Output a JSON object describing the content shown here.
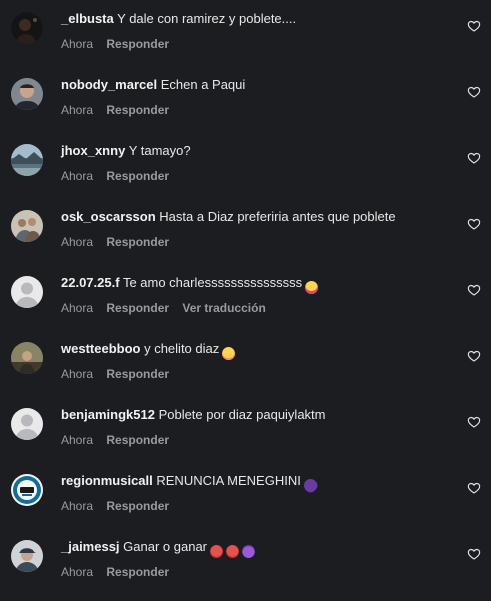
{
  "comments": [
    {
      "user": "_elbusta",
      "text": "Y dale con ramirez y poblete....",
      "time": "Ahora",
      "reply": "Responder",
      "translate": "",
      "emoji": [],
      "avatar": "dark-photo"
    },
    {
      "user": "nobody_marcel",
      "text": "Echen a Paqui",
      "time": "Ahora",
      "reply": "Responder",
      "translate": "",
      "emoji": [],
      "avatar": "portrait-photo"
    },
    {
      "user": "jhox_xnny",
      "text": "Y tamayo?",
      "time": "Ahora",
      "reply": "Responder",
      "translate": "",
      "emoji": [],
      "avatar": "landscape-photo"
    },
    {
      "user": "osk_oscarsson",
      "text": "Hasta a Diaz preferiria antes que poblete",
      "time": "Ahora",
      "reply": "Responder",
      "translate": "",
      "emoji": [],
      "avatar": "group-photo"
    },
    {
      "user": "22.07.25.f",
      "text": "Te amo charlesssssssssssssss",
      "time": "Ahora",
      "reply": "Responder",
      "translate": "Ver traducción",
      "emoji": [
        "star-struck-emoji"
      ],
      "avatar": "default"
    },
    {
      "user": "westteebboo",
      "text": "y chelito diaz",
      "time": "Ahora",
      "reply": "Responder",
      "translate": "",
      "emoji": [
        "flushed-emoji"
      ],
      "avatar": "outdoor-photo"
    },
    {
      "user": "benjamingk512",
      "text": "Poblete por diaz paquiylaktm",
      "time": "Ahora",
      "reply": "Responder",
      "translate": "",
      "emoji": [],
      "avatar": "default"
    },
    {
      "user": "regionmusicall",
      "text": "RENUNCIA MENEGHINI",
      "time": "Ahora",
      "reply": "Responder",
      "translate": "",
      "emoji": [
        "purple-heart-emoji"
      ],
      "avatar": "logo"
    },
    {
      "user": "_jaimessj",
      "text": "Ganar o ganar",
      "time": "Ahora",
      "reply": "Responder",
      "translate": "",
      "emoji": [
        "angry-face-emoji",
        "angry-face-emoji",
        "devil-emoji"
      ],
      "avatar": "cap-photo"
    }
  ],
  "colors": {
    "background": "#1c1d21",
    "username": "#f2f2f2",
    "meta": "#9a9a9e",
    "heart_outline": "#e0e0e0"
  }
}
